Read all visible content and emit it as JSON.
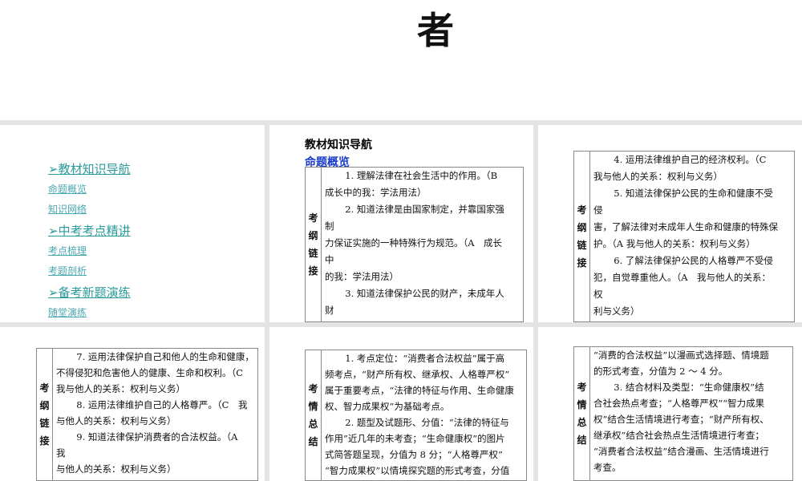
{
  "title_char": "者",
  "nav": {
    "sections": [
      {
        "label": "➢教材知识导航",
        "items": [
          "命题概览",
          "知识网络"
        ]
      },
      {
        "label": "➢中考考点精讲",
        "items": [
          "考点梳理",
          "考题剖析"
        ]
      },
      {
        "label": "➢备考新题演练",
        "items": [
          "随堂演练"
        ]
      }
    ]
  },
  "slide2": {
    "heading": "教材知识导航",
    "subheading": "命题概览",
    "label": [
      "考",
      "纲",
      "链",
      "接"
    ],
    "lines": [
      "1. 理解法律在社会生活中的作用。（B",
      "成长中的我：学法用法）",
      "2. 知道法律是由国家制定，并靠国家强",
      "制",
      "力保证实施的一种特殊行为规范。（A　成长",
      "中",
      "的我：学法用法）",
      "3. 知道法律保护公民的财产，未成年人",
      "财"
    ]
  },
  "slide3": {
    "label": [
      "考",
      "纲",
      "链",
      "接"
    ],
    "lines": [
      "4. 运用法律维护自己的经济权利。（C",
      "我与他人的关系：权利与义务）",
      "5. 知道法律保护公民的生命和健康不受",
      "侵",
      "害，了解法律对未成年人生命和健康的特殊保",
      "护。（A 我与他人的关系：权利与义务）",
      "6. 了解法律保护公民的人格尊严不受侵",
      "犯，自觉尊重他人。（A　我与他人的关系：",
      "权",
      "利与义务）"
    ]
  },
  "slide4": {
    "label": [
      "考",
      "纲",
      "链",
      "接"
    ],
    "lines": [
      "7. 运用法律保护自己和他人的生命和健康，",
      "不得侵犯和危害他人的健康、生命和权利。（C",
      "我与他人的关系：权利与义务）",
      "8. 运用法律维护自己的人格尊严。（C　我",
      "与他人的关系：权利与义务）",
      "9. 知道法律保护消费者的合法权益。（A",
      "我",
      "与他人的关系：权利与义务）"
    ]
  },
  "slide5": {
    "label": [
      "考",
      "情",
      "总",
      "结"
    ],
    "lines": [
      "1. 考点定位：“消费者合法权益”属于高",
      "频考点，“财产所有权、继承权、人格尊严权”",
      "属于重要考点，“法律的特征与作用、生命健康",
      "权、智力成果权”为基础考点。",
      "2. 题型及试题形、分值：“法律的特征与",
      "作用”近几年的未考查；“生命健康权”的图片",
      "式简答题呈现，分值为 8 分；“人格尊严权”",
      "“智力成果权”以情境探究题的形式考查，分值"
    ]
  },
  "slide6": {
    "label": [
      "考",
      "情",
      "总",
      "结"
    ],
    "lines": [
      "“消费的合法权益”以漫画式选择题、情境题",
      "的形式考查，分值为 2 ～ 4 分。",
      "3. 结合材料及类型：“生命健康权”结",
      "合社会热点考查；“人格尊严权”“智力成果",
      "权”结合生活情境进行考查；“财产所有权、",
      "继承权”结合社会热点生活情境进行考查；",
      "“消费者合法权益”结合漫画、生活情境进行",
      "考查。"
    ]
  }
}
